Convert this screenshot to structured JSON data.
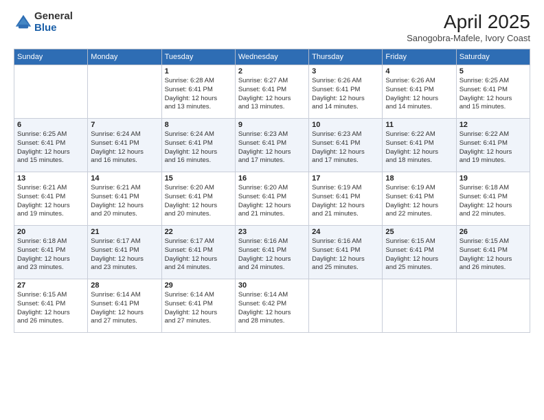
{
  "logo": {
    "general": "General",
    "blue": "Blue"
  },
  "header": {
    "title": "April 2025",
    "subtitle": "Sanogobra-Mafele, Ivory Coast"
  },
  "weekdays": [
    "Sunday",
    "Monday",
    "Tuesday",
    "Wednesday",
    "Thursday",
    "Friday",
    "Saturday"
  ],
  "weeks": [
    [
      {
        "day": "",
        "info": ""
      },
      {
        "day": "",
        "info": ""
      },
      {
        "day": "1",
        "info": "Sunrise: 6:28 AM\nSunset: 6:41 PM\nDaylight: 12 hours\nand 13 minutes."
      },
      {
        "day": "2",
        "info": "Sunrise: 6:27 AM\nSunset: 6:41 PM\nDaylight: 12 hours\nand 13 minutes."
      },
      {
        "day": "3",
        "info": "Sunrise: 6:26 AM\nSunset: 6:41 PM\nDaylight: 12 hours\nand 14 minutes."
      },
      {
        "day": "4",
        "info": "Sunrise: 6:26 AM\nSunset: 6:41 PM\nDaylight: 12 hours\nand 14 minutes."
      },
      {
        "day": "5",
        "info": "Sunrise: 6:25 AM\nSunset: 6:41 PM\nDaylight: 12 hours\nand 15 minutes."
      }
    ],
    [
      {
        "day": "6",
        "info": "Sunrise: 6:25 AM\nSunset: 6:41 PM\nDaylight: 12 hours\nand 15 minutes."
      },
      {
        "day": "7",
        "info": "Sunrise: 6:24 AM\nSunset: 6:41 PM\nDaylight: 12 hours\nand 16 minutes."
      },
      {
        "day": "8",
        "info": "Sunrise: 6:24 AM\nSunset: 6:41 PM\nDaylight: 12 hours\nand 16 minutes."
      },
      {
        "day": "9",
        "info": "Sunrise: 6:23 AM\nSunset: 6:41 PM\nDaylight: 12 hours\nand 17 minutes."
      },
      {
        "day": "10",
        "info": "Sunrise: 6:23 AM\nSunset: 6:41 PM\nDaylight: 12 hours\nand 17 minutes."
      },
      {
        "day": "11",
        "info": "Sunrise: 6:22 AM\nSunset: 6:41 PM\nDaylight: 12 hours\nand 18 minutes."
      },
      {
        "day": "12",
        "info": "Sunrise: 6:22 AM\nSunset: 6:41 PM\nDaylight: 12 hours\nand 19 minutes."
      }
    ],
    [
      {
        "day": "13",
        "info": "Sunrise: 6:21 AM\nSunset: 6:41 PM\nDaylight: 12 hours\nand 19 minutes."
      },
      {
        "day": "14",
        "info": "Sunrise: 6:21 AM\nSunset: 6:41 PM\nDaylight: 12 hours\nand 20 minutes."
      },
      {
        "day": "15",
        "info": "Sunrise: 6:20 AM\nSunset: 6:41 PM\nDaylight: 12 hours\nand 20 minutes."
      },
      {
        "day": "16",
        "info": "Sunrise: 6:20 AM\nSunset: 6:41 PM\nDaylight: 12 hours\nand 21 minutes."
      },
      {
        "day": "17",
        "info": "Sunrise: 6:19 AM\nSunset: 6:41 PM\nDaylight: 12 hours\nand 21 minutes."
      },
      {
        "day": "18",
        "info": "Sunrise: 6:19 AM\nSunset: 6:41 PM\nDaylight: 12 hours\nand 22 minutes."
      },
      {
        "day": "19",
        "info": "Sunrise: 6:18 AM\nSunset: 6:41 PM\nDaylight: 12 hours\nand 22 minutes."
      }
    ],
    [
      {
        "day": "20",
        "info": "Sunrise: 6:18 AM\nSunset: 6:41 PM\nDaylight: 12 hours\nand 23 minutes."
      },
      {
        "day": "21",
        "info": "Sunrise: 6:17 AM\nSunset: 6:41 PM\nDaylight: 12 hours\nand 23 minutes."
      },
      {
        "day": "22",
        "info": "Sunrise: 6:17 AM\nSunset: 6:41 PM\nDaylight: 12 hours\nand 24 minutes."
      },
      {
        "day": "23",
        "info": "Sunrise: 6:16 AM\nSunset: 6:41 PM\nDaylight: 12 hours\nand 24 minutes."
      },
      {
        "day": "24",
        "info": "Sunrise: 6:16 AM\nSunset: 6:41 PM\nDaylight: 12 hours\nand 25 minutes."
      },
      {
        "day": "25",
        "info": "Sunrise: 6:15 AM\nSunset: 6:41 PM\nDaylight: 12 hours\nand 25 minutes."
      },
      {
        "day": "26",
        "info": "Sunrise: 6:15 AM\nSunset: 6:41 PM\nDaylight: 12 hours\nand 26 minutes."
      }
    ],
    [
      {
        "day": "27",
        "info": "Sunrise: 6:15 AM\nSunset: 6:41 PM\nDaylight: 12 hours\nand 26 minutes."
      },
      {
        "day": "28",
        "info": "Sunrise: 6:14 AM\nSunset: 6:41 PM\nDaylight: 12 hours\nand 27 minutes."
      },
      {
        "day": "29",
        "info": "Sunrise: 6:14 AM\nSunset: 6:41 PM\nDaylight: 12 hours\nand 27 minutes."
      },
      {
        "day": "30",
        "info": "Sunrise: 6:14 AM\nSunset: 6:42 PM\nDaylight: 12 hours\nand 28 minutes."
      },
      {
        "day": "",
        "info": ""
      },
      {
        "day": "",
        "info": ""
      },
      {
        "day": "",
        "info": ""
      }
    ]
  ]
}
